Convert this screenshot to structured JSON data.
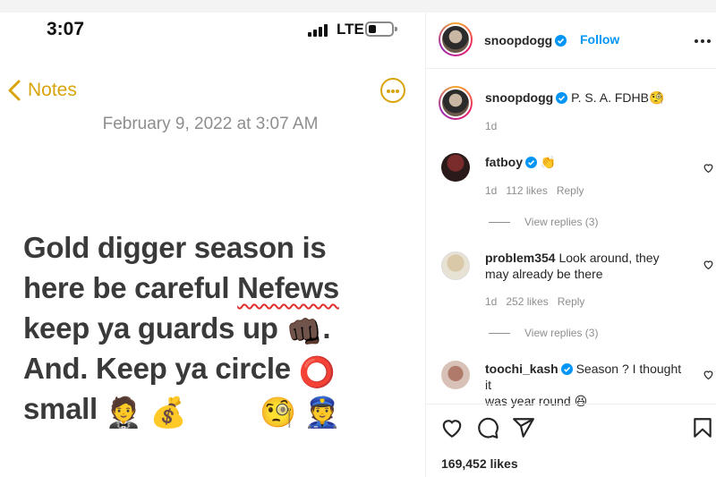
{
  "notes": {
    "status_time": "3:07",
    "network": "LTE",
    "back_label": "Notes",
    "date": "February 9, 2022 at 3:07 AM",
    "lines": [
      "Gold digger season is",
      "here  be careful ",
      "Nefews",
      "keep ya guards up ",
      "👊🏿",
      ".",
      "And. Keep ya circle ",
      "⭕",
      "small ",
      "🤵",
      "💰",
      "🧐",
      "👮"
    ]
  },
  "post": {
    "author": "snoopdogg",
    "follow_label": "Follow",
    "caption": "P. S. A. FDHB",
    "caption_emoji": "🧐",
    "caption_age": "1d",
    "likes": "169,452 likes"
  },
  "comments": [
    {
      "user": "fatboy",
      "verified": true,
      "text": "👏",
      "age": "1d",
      "likes": "112 likes",
      "reply": "Reply",
      "view_replies": "View replies (3)"
    },
    {
      "user": "problem354",
      "verified": false,
      "text_line1": "Look around, they",
      "text_line2": "may already be there",
      "age": "1d",
      "likes": "252 likes",
      "reply": "Reply",
      "view_replies": "View replies (3)"
    },
    {
      "user": "toochi_kash",
      "verified": true,
      "text_line1": "Season ? I thought it",
      "text_line2": "was year round",
      "emoji": "😆"
    }
  ],
  "colors": {
    "notes_accent": "#d9a40b",
    "verified_blue": "#0095f6",
    "follow_blue": "#0095f6",
    "spell_underline": "#e0302e"
  },
  "icons": [
    "chevron-left-icon",
    "ellipsis-circle-icon",
    "verified-badge-icon",
    "more-horizontal-icon",
    "heart-icon",
    "comment-icon",
    "share-icon",
    "bookmark-icon"
  ]
}
